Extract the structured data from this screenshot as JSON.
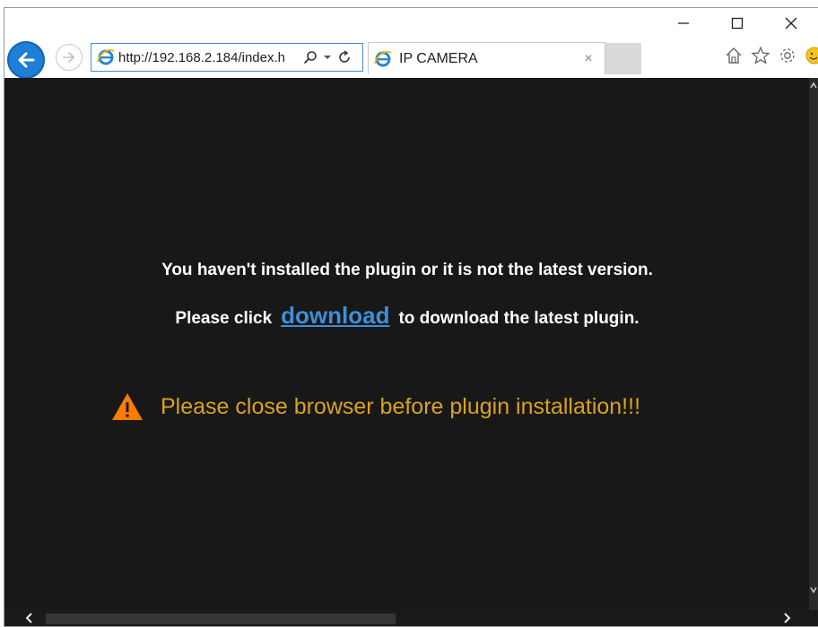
{
  "window": {
    "controls": [
      "minimize",
      "maximize",
      "close"
    ]
  },
  "nav": {
    "address": "http://192.168.2.184/index.h",
    "tab_title": "IP CAMERA",
    "tab_close": "×"
  },
  "page": {
    "line1": "You haven't installed the plugin or it is not the latest version.",
    "line2_prefix": "Please click",
    "download_link": "download",
    "line2_suffix": "to download the latest plugin.",
    "warning": "Please close browser before plugin installation!!!"
  },
  "colors": {
    "page_bg": "#181818",
    "link": "#3e8fd8",
    "warning_text": "#d9a21f",
    "warning_icon": "#ff7a00",
    "back_button": "#1f7ed6"
  },
  "icons": {
    "back": "arrow-left",
    "forward": "arrow-right",
    "site": "internet-explorer-logo",
    "search": "magnifier",
    "dropdown": "chevron-down",
    "refresh": "refresh",
    "home": "home",
    "favorites": "star",
    "settings": "gear",
    "feedback": "smiley",
    "warning": "warning-triangle"
  }
}
